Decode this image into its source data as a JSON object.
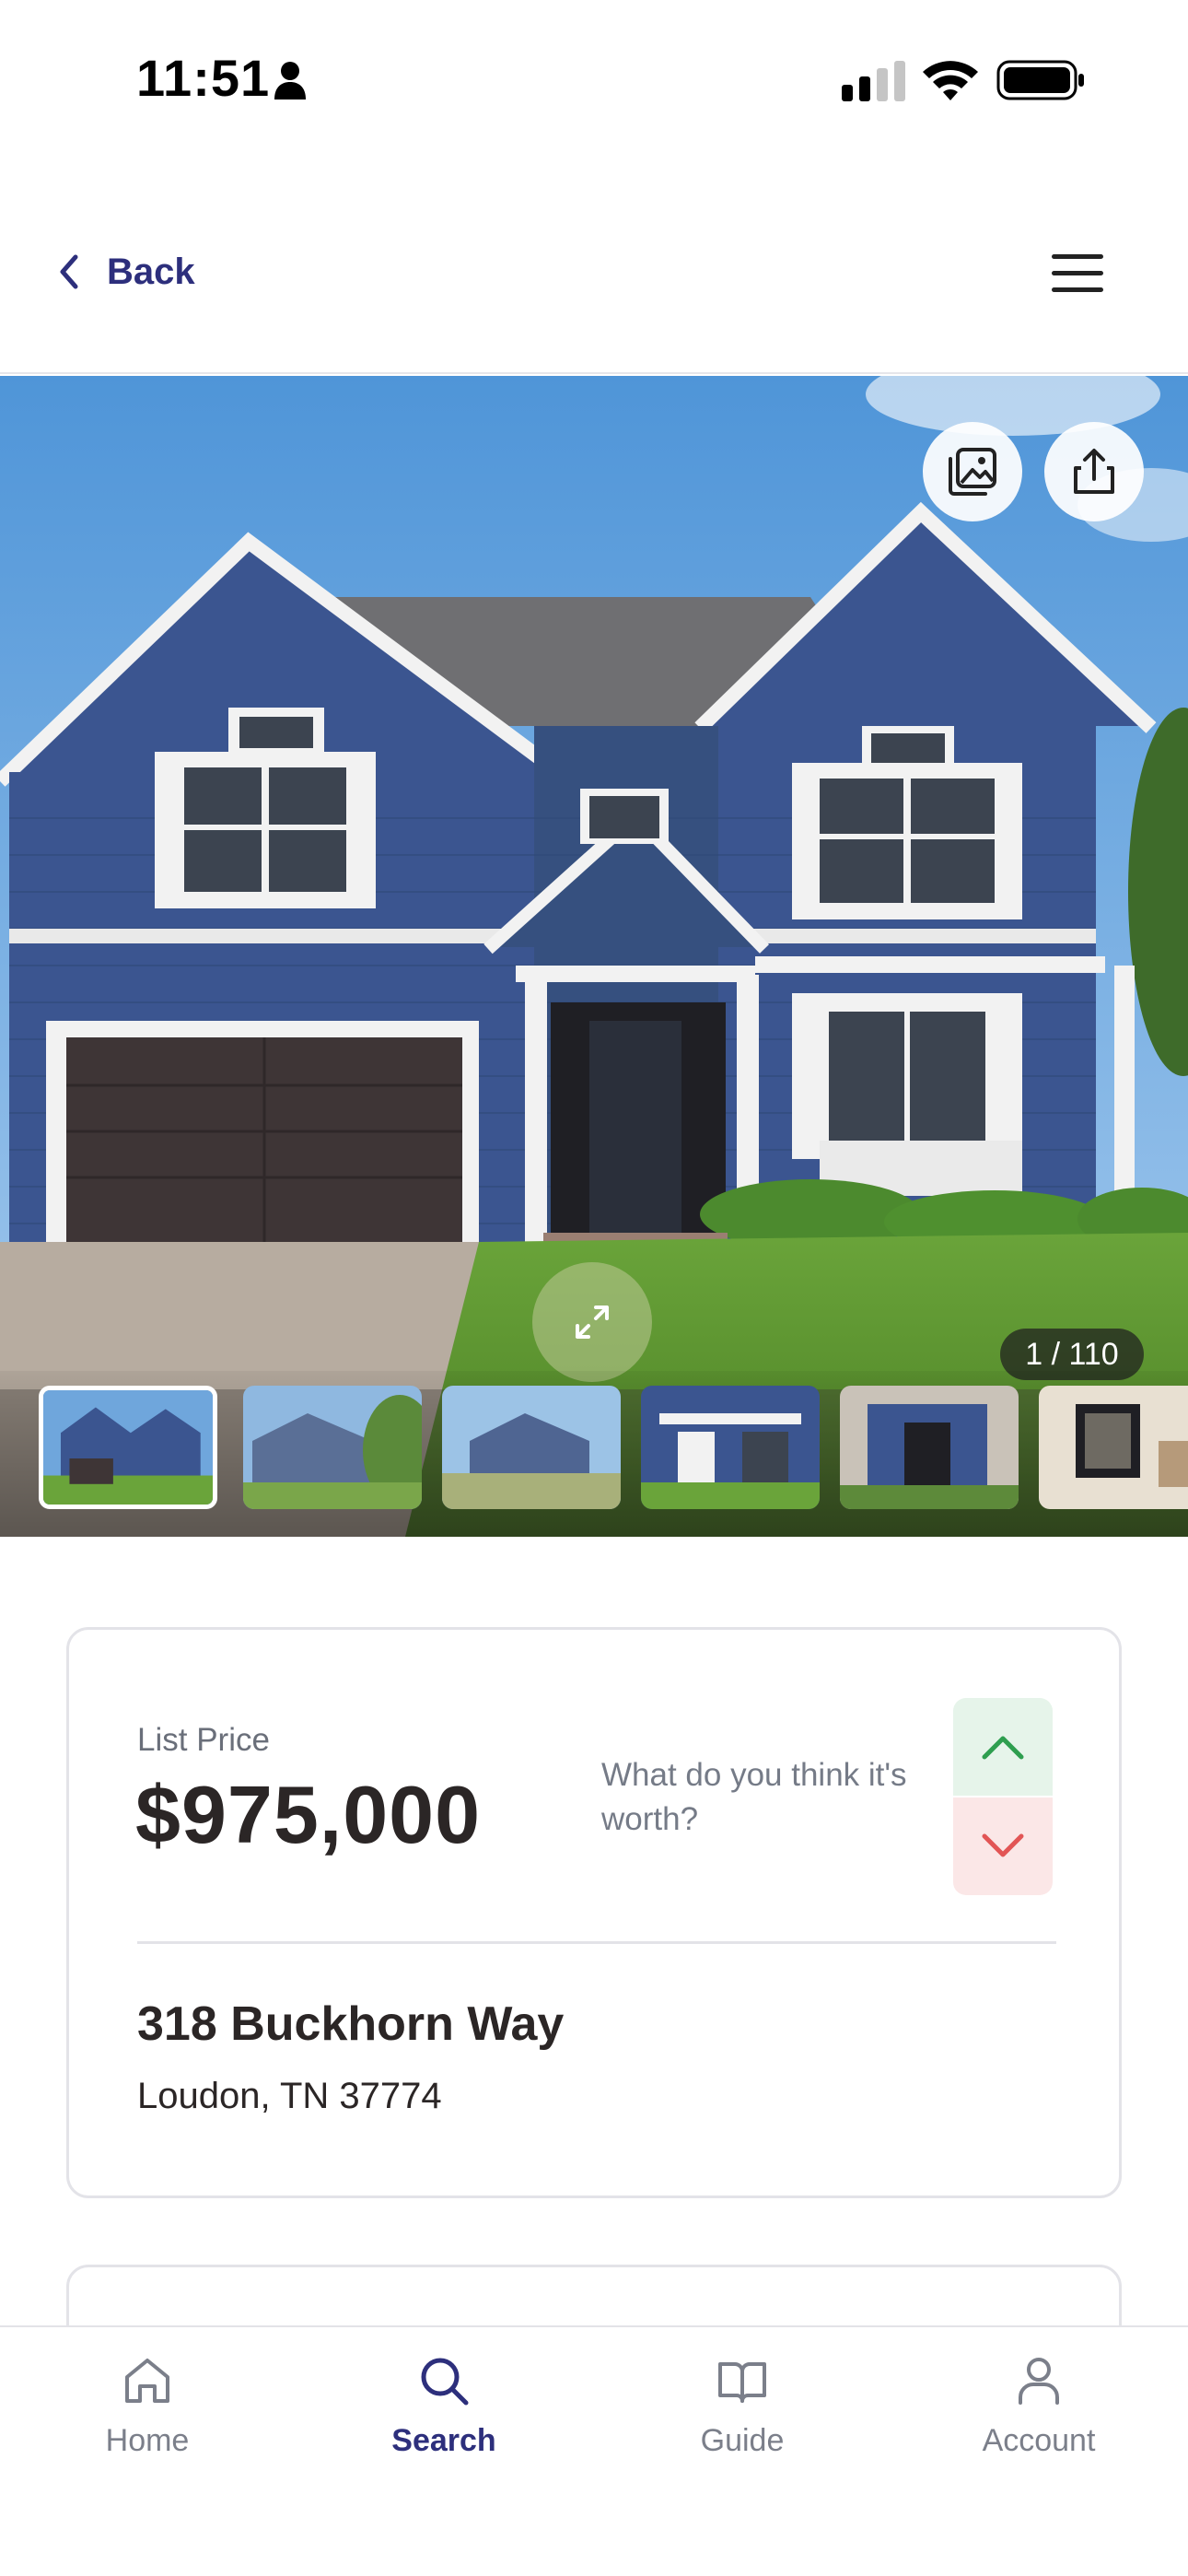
{
  "status_bar": {
    "time": "11:51"
  },
  "header": {
    "back_label": "Back"
  },
  "gallery": {
    "counter": "1 / 110",
    "thumbnail_count": 6
  },
  "listing": {
    "price_label": "List Price",
    "price": "$975,000",
    "worth_question": "What do you think it's worth?",
    "street": "318 Buckhorn Way",
    "city_state_zip": "Loudon, TN 37774"
  },
  "tabs": [
    {
      "label": "Home",
      "icon": "home-icon",
      "active": false
    },
    {
      "label": "Search",
      "icon": "search-icon",
      "active": true
    },
    {
      "label": "Guide",
      "icon": "book-icon",
      "active": false
    },
    {
      "label": "Account",
      "icon": "user-icon",
      "active": false
    }
  ],
  "colors": {
    "brand": "#2d2f7c",
    "text": "#2b2626",
    "up_bg": "#e6f4ea",
    "up_icon": "#2e9e4f",
    "down_bg": "#fbe7e7",
    "down_icon": "#e25555",
    "house_siding": "#3b5590"
  }
}
